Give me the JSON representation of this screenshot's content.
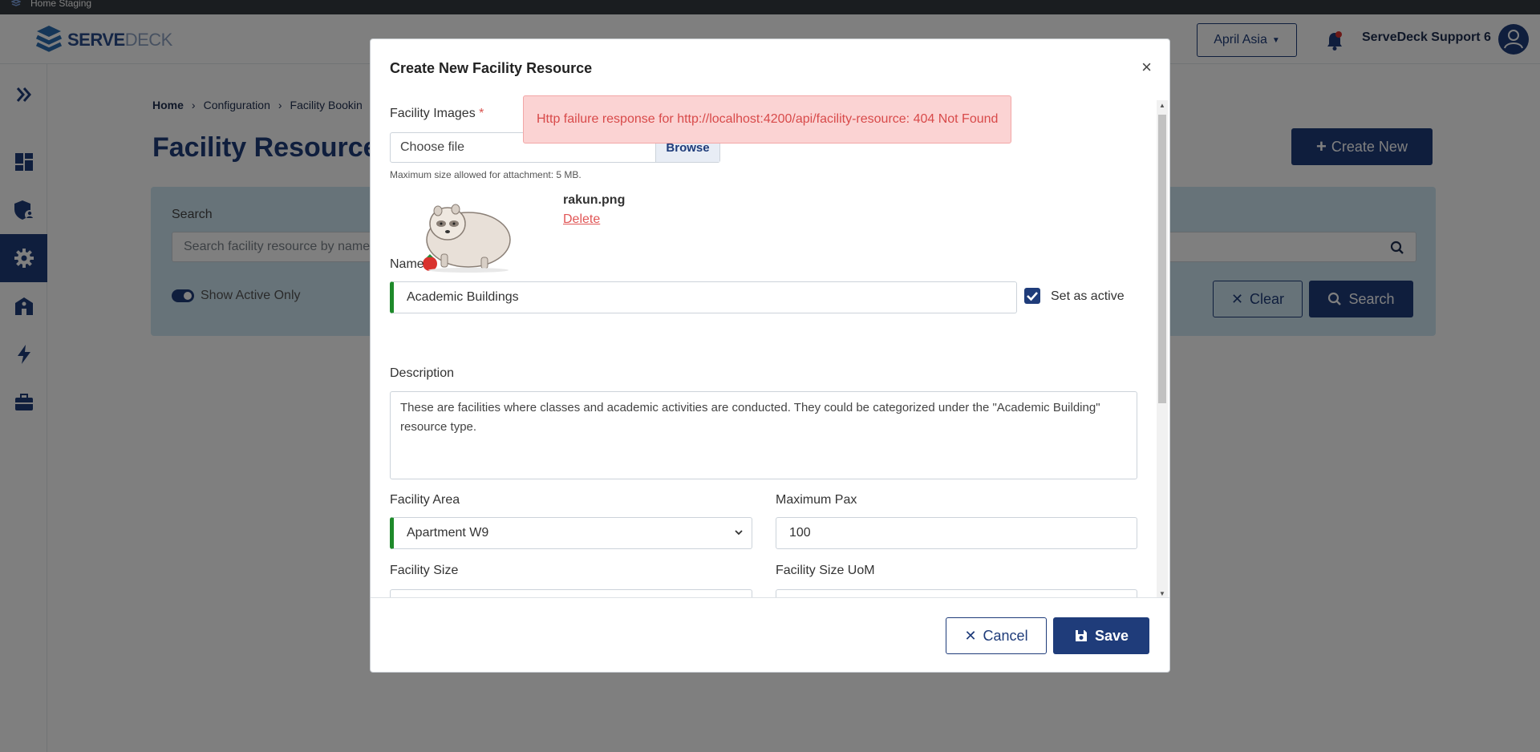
{
  "os": {
    "title": "Home Staging"
  },
  "header": {
    "logo_bold": "SERVE",
    "logo_light": "DECK",
    "region": "April Asia",
    "user_name": "ServeDeck Support 6"
  },
  "sidebar": {
    "items": [
      {
        "icon": "expand-icon"
      },
      {
        "icon": "dashboard-icon"
      },
      {
        "icon": "shield-user-icon"
      },
      {
        "icon": "gear-icon",
        "active": true
      },
      {
        "icon": "building-icon"
      },
      {
        "icon": "bolt-icon"
      },
      {
        "icon": "briefcase-icon"
      }
    ]
  },
  "page": {
    "breadcrumb": [
      "Home",
      "Configuration",
      "Facility Bookin"
    ],
    "title": "Facility Resource",
    "create_new": "Create New",
    "search_label": "Search",
    "search_placeholder": "Search facility resource by name/",
    "show_active_only": "Show Active Only",
    "clear": "Clear",
    "search": "Search"
  },
  "toast": {
    "message": "Http failure response for http://localhost:4200/api/facility-resource: 404 Not Found"
  },
  "modal": {
    "title": "Create New Facility Resource",
    "images_label": "Facility Images",
    "required_mark": "*",
    "file_placeholder": "Choose file",
    "browse": "Browse",
    "max_size_hint": "Maximum size allowed for attachment: 5 MB.",
    "file_name": "rakun.png",
    "delete": "Delete",
    "name_label": "Name",
    "name_value": "Academic Buildings",
    "set_active_label": "Set as active",
    "set_active_checked": true,
    "description_label": "Description",
    "description_value": "These are facilities where classes and academic activities are conducted. They could be categorized under the \"Academic Building\" resource type.",
    "area_label": "Facility Area",
    "area_value": "Apartment W9",
    "pax_label": "Maximum Pax",
    "pax_value": "100",
    "size_label": "Facility Size",
    "size_uom_label": "Facility Size UoM",
    "cancel": "Cancel",
    "save": "Save"
  },
  "colors": {
    "primary": "#1f3c7a",
    "valid": "#1e8a2a",
    "error_bg": "#fbd3d3",
    "error_text": "#d84a4a",
    "panel_bg": "#cfe7f3"
  }
}
